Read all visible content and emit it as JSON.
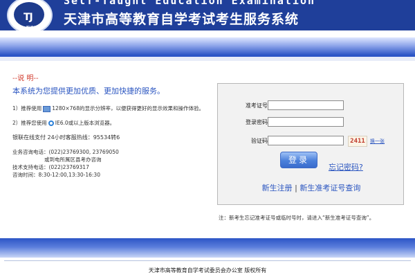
{
  "header": {
    "title_en": "Self-Taught Education Examination",
    "title_cn": "天津市高等教育自学考试考生服务系统",
    "logo_abbr": "TJEEA"
  },
  "notice": {
    "title": "--说 明--",
    "intro": "本系统为您提供更加优质、更加快捷的服务。",
    "tip1_a": "1）推荐使用",
    "tip1_b": "1280×768的显示分辨率，以便获得更好的显示效果和操作体验。",
    "tip2_a": "2）推荐您使用",
    "tip2_b": "IE6.0或以上版本浏览器。",
    "hotline": "银联在线支付 24小时客服热线：95534转6",
    "consult_label": "业务咨询电话：",
    "consult_value": "(022)23769300, 23769050",
    "consult_note": "或到电所属区县考办咨询",
    "tech_label": "技术支持电话：",
    "tech_value": "(022)23769317",
    "hours_label": "咨询时间：",
    "hours_value": "8:30-12:00,13:30-16:30"
  },
  "login": {
    "ticket_label": "准考证号：",
    "ticket_value": "",
    "password_label": "登录密码：",
    "password_value": "",
    "captcha_label": "验证码：",
    "captcha_value": "",
    "captcha_code": "2411",
    "refresh_link": "换一张",
    "login_button": "登录",
    "forgot_link": "忘记密码?",
    "register_link": "新生注册",
    "separator": "|",
    "query_link": "新生准考证号查询"
  },
  "note": "注：新考生忘记准考证号或临时号时，请进入“新生准考证号查询”。",
  "footer": "天津市高等教育自学考试委员会办公室 版权所有",
  "colors": {
    "header_bg": "#1f3f9a",
    "accent_blue": "#2a55c0",
    "notice_red": "#d13a2c"
  }
}
